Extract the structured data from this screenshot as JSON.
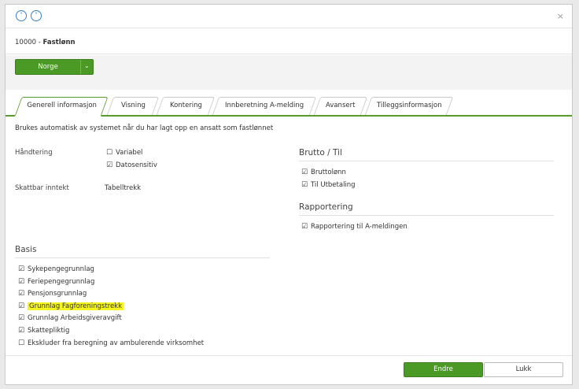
{
  "nav": {
    "up_icon": "˄",
    "down_icon": "˅",
    "close_icon": "×"
  },
  "title": {
    "number": "10000",
    "separator": " - ",
    "name": "Fastlønn"
  },
  "country": {
    "label": "Norge",
    "caret": "⌄"
  },
  "tabs": [
    {
      "label": "Generell informasjon",
      "active": true
    },
    {
      "label": "Visning"
    },
    {
      "label": "Kontering"
    },
    {
      "label": "Innberetning A-melding"
    },
    {
      "label": "Avansert"
    },
    {
      "label": "Tilleggsinformasjon"
    }
  ],
  "description": "Brukes automatisk av systemet når du har lagt opp en ansatt som fastlønnet",
  "handtering": {
    "label": "Håndtering",
    "options": [
      {
        "label": "Variabel",
        "checked": false
      },
      {
        "label": "Datosensitiv",
        "checked": true
      }
    ]
  },
  "skattbar": {
    "label": "Skattbar inntekt",
    "value": "Tabelltrekk"
  },
  "brutto": {
    "heading": "Brutto / Til",
    "options": [
      {
        "label": "Bruttolønn",
        "checked": true
      },
      {
        "label": "Til Utbetaling",
        "checked": true
      }
    ]
  },
  "rapportering": {
    "heading": "Rapportering",
    "options": [
      {
        "label": "Rapportering til A-meldingen",
        "checked": true
      }
    ]
  },
  "basis": {
    "heading": "Basis",
    "options": [
      {
        "label": "Sykepengegrunnlag",
        "checked": true
      },
      {
        "label": "Feriepengegrunnlag",
        "checked": true
      },
      {
        "label": "Pensjonsgrunnlag",
        "checked": true
      },
      {
        "label": "Grunnlag Fagforeningstrekk",
        "checked": true,
        "highlighted": true
      },
      {
        "label": "Grunnlag Arbeidsgiveravgift",
        "checked": true
      },
      {
        "label": "Skattepliktig",
        "checked": true
      },
      {
        "label": "Ekskluder fra beregning av ambulerende virksomhet",
        "checked": false
      }
    ]
  },
  "footer": {
    "edit_label": "Endre",
    "close_label": "Lukk"
  },
  "glyphs": {
    "checked": "☑",
    "unchecked": "☐"
  },
  "colors": {
    "accent": "#4b9a26",
    "highlight": "#f5f51e",
    "nav_blue": "#3b7fc4"
  }
}
